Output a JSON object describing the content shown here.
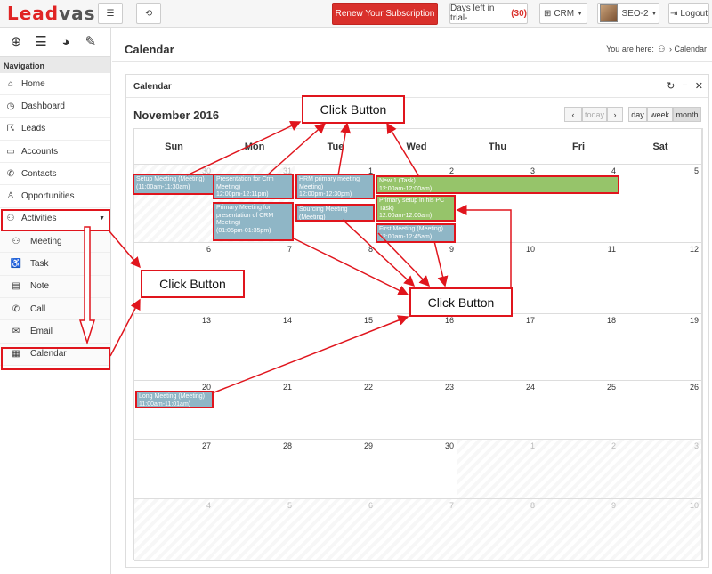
{
  "app": {
    "logo_part1": "Lead",
    "logo_part2": "vas",
    "renew_label": "Renew Your Subscription",
    "trial_label": "Days left in trial-",
    "trial_count": "(30)",
    "module_label": "CRM",
    "user_label": "SEO-2",
    "logout_label": "Logout"
  },
  "sidebar": {
    "nav_heading": "Navigation",
    "items": [
      {
        "label": "Home",
        "icon": "home-icon"
      },
      {
        "label": "Dashboard",
        "icon": "dashboard-icon"
      },
      {
        "label": "Leads",
        "icon": "leads-icon"
      },
      {
        "label": "Accounts",
        "icon": "accounts-icon"
      },
      {
        "label": "Contacts",
        "icon": "contacts-icon"
      },
      {
        "label": "Opportunities",
        "icon": "opportunities-icon"
      },
      {
        "label": "Activities",
        "icon": "activities-icon"
      }
    ],
    "subitems": [
      {
        "label": "Meeting",
        "icon": "meeting-icon"
      },
      {
        "label": "Task",
        "icon": "task-icon"
      },
      {
        "label": "Note",
        "icon": "note-icon"
      },
      {
        "label": "Call",
        "icon": "call-icon"
      },
      {
        "label": "Email",
        "icon": "email-icon"
      },
      {
        "label": "Calendar",
        "icon": "calendar-icon"
      }
    ]
  },
  "page": {
    "title": "Calendar",
    "crumb_prefix": "You are here:",
    "crumb_current": "Calendar"
  },
  "panel": {
    "title": "Calendar"
  },
  "calendar": {
    "month_title": "November 2016",
    "today_label": "today",
    "view_day": "day",
    "view_week": "week",
    "view_month": "month",
    "days_of_week": [
      "Sun",
      "Mon",
      "Tue",
      "Wed",
      "Thu",
      "Fri",
      "Sat"
    ],
    "weeks": [
      [
        "30",
        "31",
        "1",
        "2",
        "3",
        "4",
        "5"
      ],
      [
        "6",
        "7",
        "8",
        "9",
        "10",
        "11",
        "12"
      ],
      [
        "13",
        "14",
        "15",
        "16",
        "17",
        "18",
        "19"
      ],
      [
        "20",
        "21",
        "22",
        "23",
        "24",
        "25",
        "26"
      ],
      [
        "27",
        "28",
        "29",
        "30",
        "1",
        "2",
        "3"
      ],
      [
        "4",
        "5",
        "6",
        "7",
        "8",
        "9",
        "10"
      ]
    ],
    "events": [
      {
        "line1": "Setup Meeting (Meeting)",
        "line2": "(11:00am-11:30am)",
        "color": "blue"
      },
      {
        "line1": "Presentation for Crm Meeting)",
        "line2": "12:00pm-12:11pm)",
        "color": "blue"
      },
      {
        "line1": "Primary Meeting for presentation of CRM Meeting)",
        "line2": "(01:05pm-01:35pm)",
        "color": "blue"
      },
      {
        "line1": "HRM primary meeting Meeting)",
        "line2": "12:00pm-12:30pm)",
        "color": "blue"
      },
      {
        "line1": "Sourcing Meeting (Meeting)",
        "line2": "12:00am-01:01am)",
        "color": "blue"
      },
      {
        "line1": "New 1 (Task)",
        "line2": "12:00am-12:00am)",
        "color": "green"
      },
      {
        "line1": "Primary setup in his PC Task)",
        "line2": "12:00am-12:00am)",
        "color": "green"
      },
      {
        "line1": "First Meeting (Meeting)",
        "line2": "12:00am-12:45am)",
        "color": "blue"
      },
      {
        "line1": "Long Meeting (Meeting)",
        "line2": "11:00am-11:01am)",
        "color": "blue"
      }
    ]
  },
  "annotations": {
    "callout_top": "Click Button",
    "callout_left": "Click Button",
    "callout_right": "Click Button",
    "accent_color": "#e0151d"
  }
}
